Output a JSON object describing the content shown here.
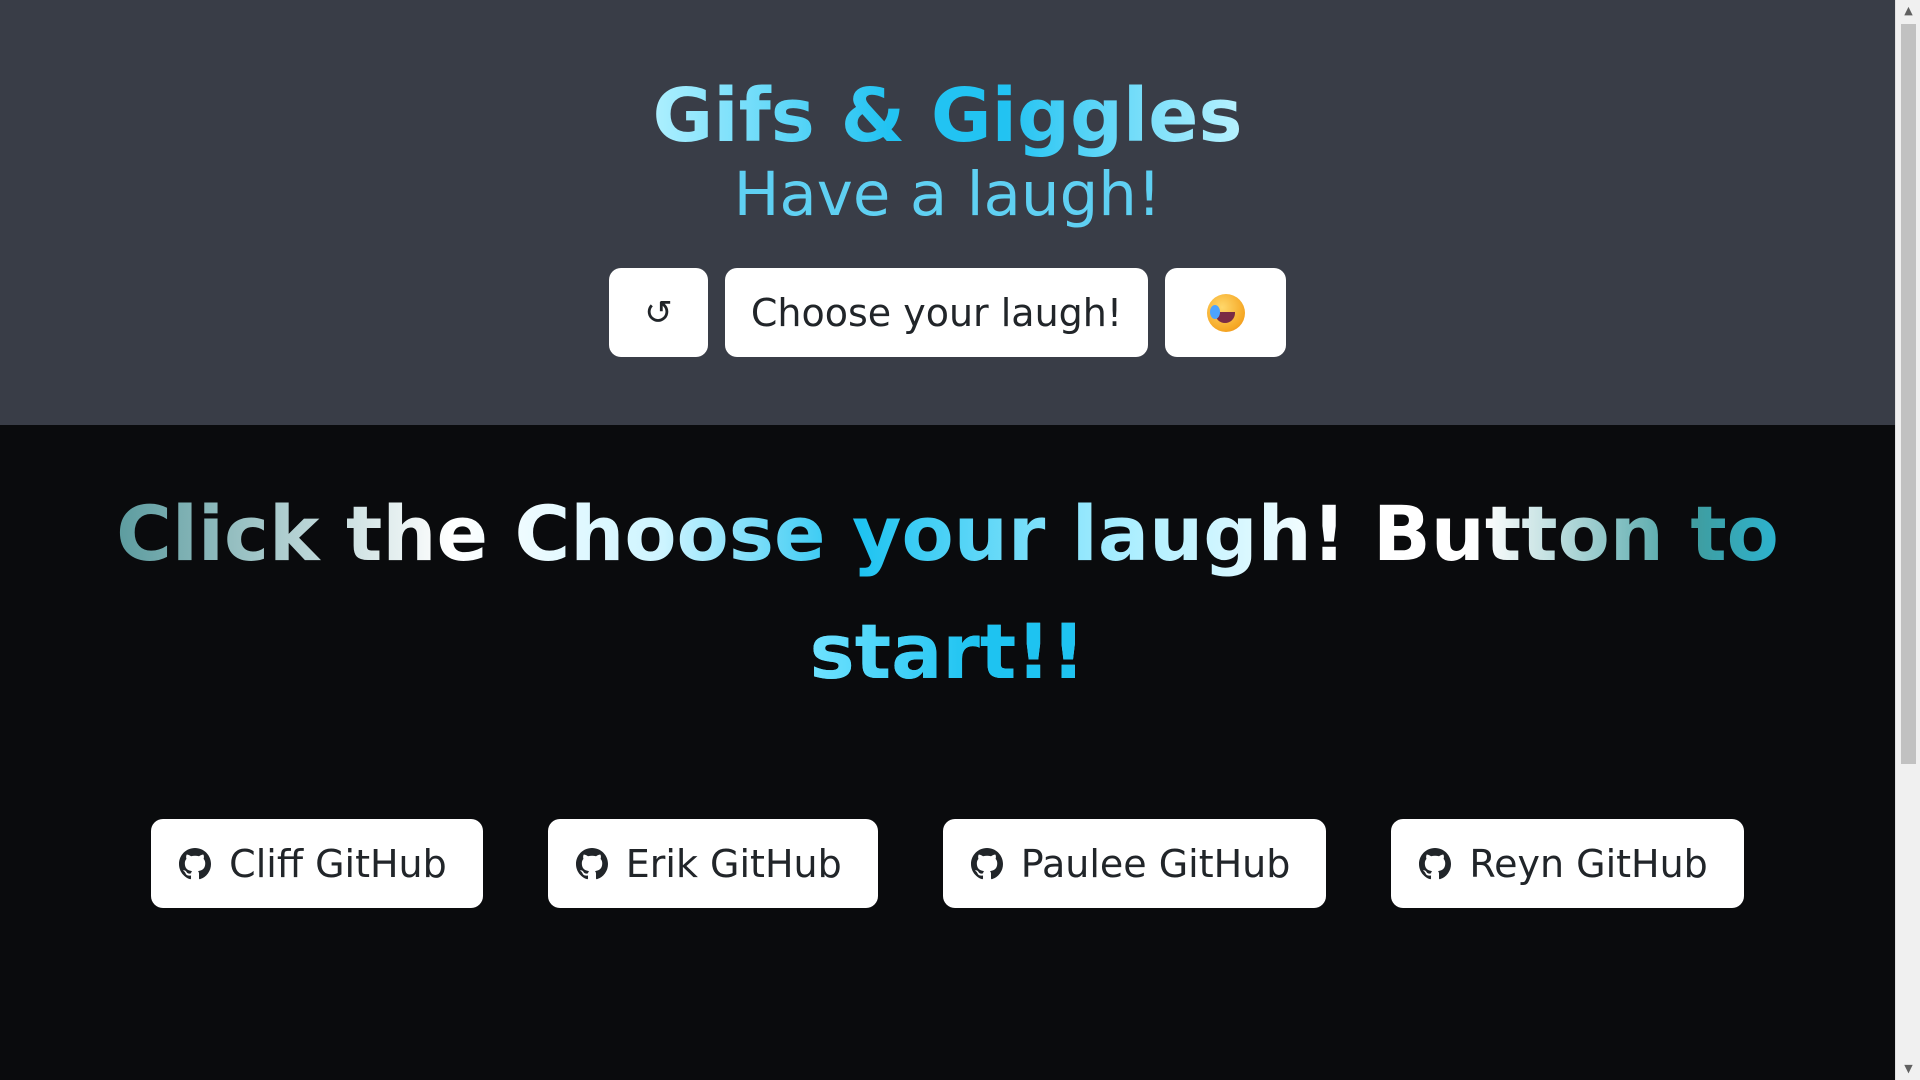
{
  "header": {
    "title": "Gifs & Giggles",
    "subtitle": "Have a laugh!",
    "refresh_label": "↺",
    "choose_label": "Choose your laugh!",
    "emoji_icon": "rolling-on-floor-laughing-icon"
  },
  "main": {
    "cta_line1": "Click the Choose your laugh! Button to",
    "cta_line2": "start!!"
  },
  "links": [
    {
      "label": "Cliff GitHub",
      "icon": "github-icon"
    },
    {
      "label": "Erik GitHub",
      "icon": "github-icon"
    },
    {
      "label": "Paulee GitHub",
      "icon": "github-icon"
    },
    {
      "label": "Reyn GitHub",
      "icon": "github-icon"
    }
  ],
  "colors": {
    "header_bg": "#393d47",
    "page_bg": "#0a0b0d",
    "accent": "#22c3f2",
    "button_bg": "#ffffff"
  }
}
